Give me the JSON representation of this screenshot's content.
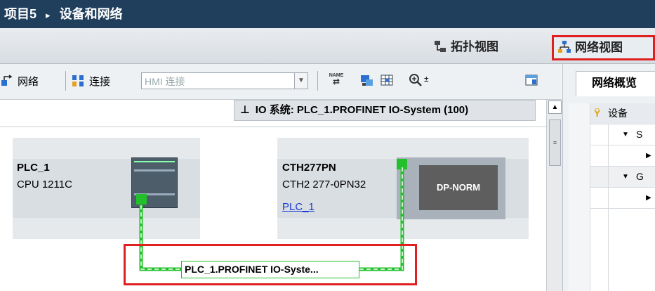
{
  "title_bar": {
    "project": "项目5",
    "separator": "▸",
    "section": "设备和网络"
  },
  "view_tabs": {
    "topology": "拓扑视图",
    "network": "网络视图"
  },
  "toolbar": {
    "network_label": "网络",
    "connections_label": "连接",
    "hmi_connection_placeholder": "HMI 连接",
    "name_icon_text": "NAME"
  },
  "canvas": {
    "io_system_bar": "IO 系统: PLC_1.PROFINET IO-System (100)",
    "devices": [
      {
        "name": "PLC_1",
        "type": "CPU 1211C"
      },
      {
        "name": "CTH277PN",
        "type": "CTH2 277-0PN32",
        "link": "PLC_1",
        "module_label": "DP-NORM"
      }
    ],
    "network_label": "PLC_1.PROFINET IO-Syste..."
  },
  "right_panel": {
    "tab": "网络概览",
    "column_header": "设备",
    "rows": [
      "S",
      "",
      "G",
      ""
    ]
  },
  "colors": {
    "title_bg": "#1f3f5c",
    "highlight": "#e02020",
    "profinet_green": "#22c02a"
  }
}
